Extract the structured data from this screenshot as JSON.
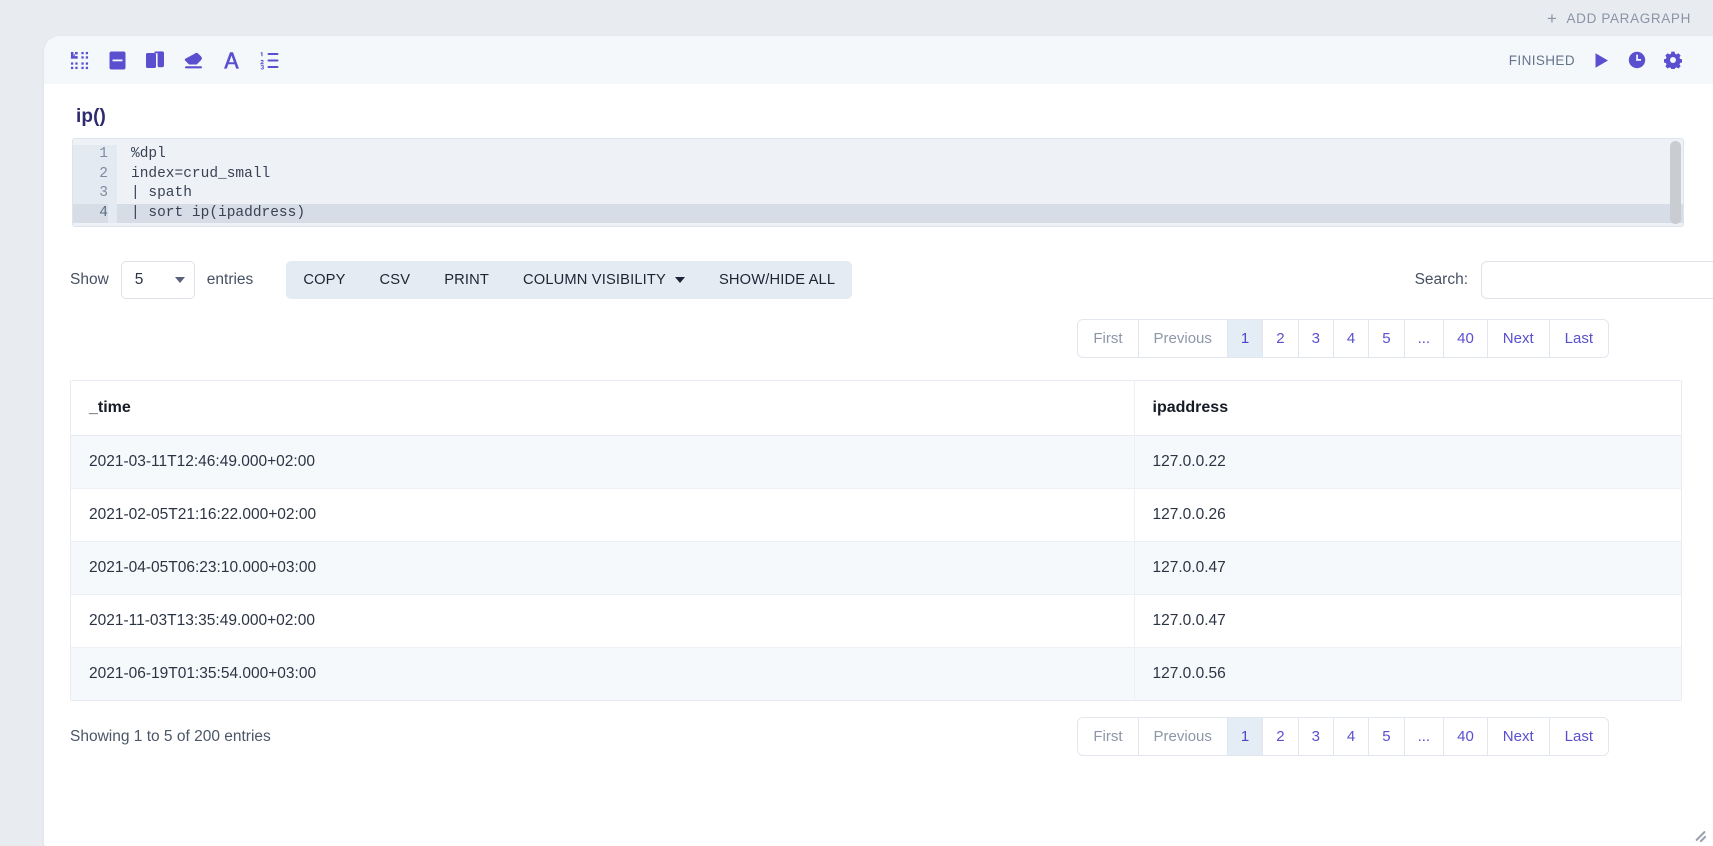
{
  "top": {
    "add_paragraph_label": "ADD PARAGRAPH",
    "plus_glyph": "+"
  },
  "paragraph": {
    "status": "FINISHED",
    "title": "ip()",
    "toolbar_icons": [
      {
        "name": "collapse-icon"
      },
      {
        "name": "book-icon"
      },
      {
        "name": "copy-icon"
      },
      {
        "name": "eraser-icon"
      },
      {
        "name": "font-icon"
      },
      {
        "name": "list-icon"
      }
    ],
    "header_icons": [
      {
        "name": "run-icon"
      },
      {
        "name": "clock-icon"
      },
      {
        "name": "gear-icon"
      }
    ]
  },
  "editor": {
    "lines": [
      {
        "no": "1",
        "text": "%dpl",
        "active": false
      },
      {
        "no": "2",
        "text": "index=crud_small",
        "active": false
      },
      {
        "no": "3",
        "text": "| spath",
        "active": false
      },
      {
        "no": "4",
        "text": "| sort ip(ipaddress)",
        "active": true
      }
    ]
  },
  "controls": {
    "show_label": "Show",
    "entries_label": "entries",
    "page_length": "5",
    "buttons": [
      {
        "label": "COPY",
        "caret": false
      },
      {
        "label": "CSV",
        "caret": false
      },
      {
        "label": "PRINT",
        "caret": false
      },
      {
        "label": "COLUMN VISIBILITY",
        "caret": true
      },
      {
        "label": "SHOW/HIDE ALL",
        "caret": false
      }
    ],
    "search_label": "Search:",
    "search_value": "",
    "search_placeholder": ""
  },
  "pagination": {
    "first": "First",
    "previous": "Previous",
    "pages": [
      "1",
      "2",
      "3",
      "4",
      "5",
      "...",
      "40"
    ],
    "active_page": "1",
    "next": "Next",
    "last": "Last"
  },
  "table": {
    "columns": [
      "_time",
      "ipaddress"
    ],
    "rows": [
      [
        "2021-03-11T12:46:49.000+02:00",
        "127.0.0.22"
      ],
      [
        "2021-02-05T21:16:22.000+02:00",
        "127.0.0.26"
      ],
      [
        "2021-04-05T06:23:10.000+03:00",
        "127.0.0.47"
      ],
      [
        "2021-11-03T13:35:49.000+02:00",
        "127.0.0.47"
      ],
      [
        "2021-06-19T01:35:54.000+03:00",
        "127.0.0.56"
      ]
    ]
  },
  "footer": {
    "showing_info": "Showing 1 to 5 of 200 entries"
  },
  "colors": {
    "accent": "#5a4fcf",
    "page_bg": "#e8ecf1",
    "header_bg": "#f5f8fb",
    "link": "#5a4fcf",
    "active_page_bg": "#e4ecf6"
  }
}
